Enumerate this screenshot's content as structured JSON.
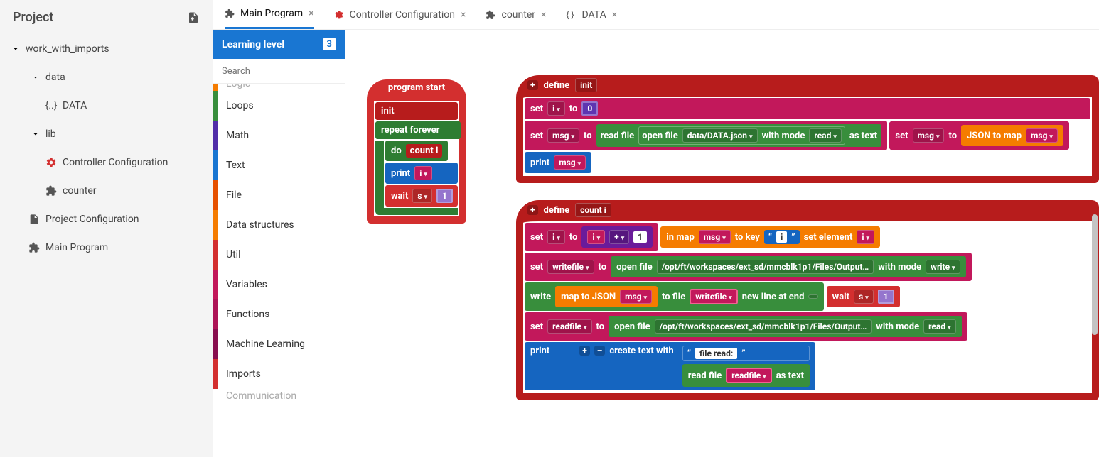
{
  "project": {
    "title": "Project",
    "root": "work_with_imports",
    "tree": {
      "data_folder": "data",
      "data_item": "DATA",
      "lib_folder": "lib",
      "controller_config": "Controller Configuration",
      "counter": "counter",
      "project_config": "Project Configuration",
      "main_program": "Main Program"
    }
  },
  "toolbox": {
    "learning_label": "Learning level",
    "learning_value": "3",
    "search_placeholder": "Search",
    "items": [
      "Logic",
      "Loops",
      "Math",
      "Text",
      "File",
      "Data structures",
      "Util",
      "Variables",
      "Functions",
      "Machine Learning",
      "Imports",
      "Communication"
    ],
    "colors": [
      "c-orange",
      "c-green",
      "c-purple",
      "c-blue",
      "c-dorange",
      "c-orange",
      "c-red",
      "c-pink",
      "c-magenta",
      "c-dpink",
      "c-red",
      "c-orange"
    ]
  },
  "tabs": [
    {
      "label": "Main Program",
      "icon": "puzzle",
      "active": true
    },
    {
      "label": "Controller Configuration",
      "icon": "gear-red",
      "active": false
    },
    {
      "label": "counter",
      "icon": "puzzle",
      "active": false
    },
    {
      "label": "DATA",
      "icon": "braces",
      "active": false
    }
  ],
  "blocks": {
    "program_start": "program start",
    "init_call": "init",
    "repeat_forever": "repeat forever",
    "do": "do",
    "count_call": "count i",
    "print": "print",
    "var_i": "i",
    "wait": "wait",
    "unit_s": "s",
    "one": "1",
    "define": "define",
    "def_init": "init",
    "set": "set",
    "to": "to",
    "zero": "0",
    "var_msg": "msg",
    "read_file": "read file",
    "open_file": "open file",
    "data_json": "data/DATA.json",
    "with_mode": "with mode",
    "read": "read",
    "as_text": "as text",
    "json_to_map": "JSON to map",
    "def_count": "count i",
    "plus_op": "+",
    "in_map": "in map",
    "to_key": "to key",
    "key_i": "i",
    "set_element": "set element",
    "var_writefile": "writefile",
    "output_path": "/opt/ft/workspaces/ext_sd/mmcblk1p1/Files/Output…",
    "write_mode": "write",
    "write_lbl": "write",
    "map_to_json": "map to JSON",
    "to_file": "to file",
    "new_line": "new line at end",
    "var_readfile": "readfile",
    "create_text": "create text with",
    "file_read_txt": "file read:",
    "plus": "+",
    "minus": "–"
  }
}
